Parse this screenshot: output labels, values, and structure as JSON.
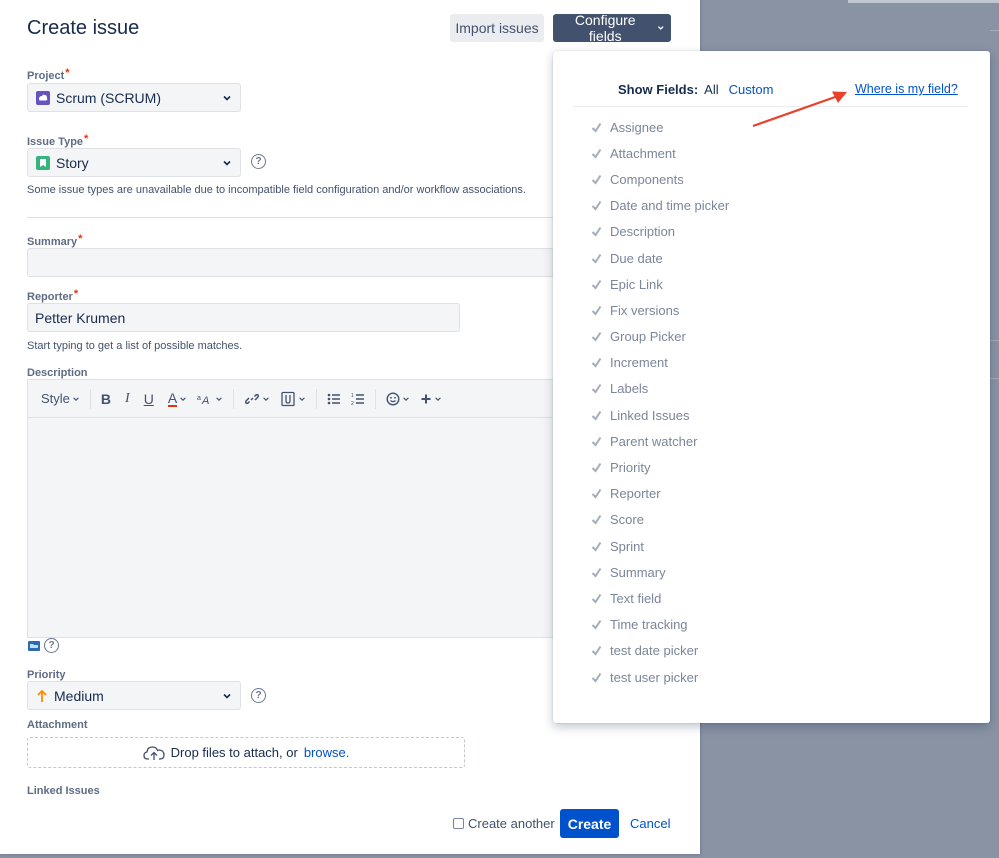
{
  "dialog": {
    "title": "Create issue",
    "import_label": "Import issues",
    "configure_label": "Configure fields"
  },
  "project": {
    "label": "Project",
    "value": "Scrum (SCRUM)"
  },
  "issue_type": {
    "label": "Issue Type",
    "value": "Story",
    "hint": "Some issue types are unavailable due to incompatible field configuration and/or workflow associations."
  },
  "summary": {
    "label": "Summary",
    "value": ""
  },
  "reporter": {
    "label": "Reporter",
    "value": "Petter Krumen",
    "hint": "Start typing to get a list of possible matches."
  },
  "description": {
    "label": "Description",
    "toolbar": {
      "style": "Style",
      "bold": "B",
      "italic": "I",
      "underline": "U",
      "color": "A"
    }
  },
  "priority": {
    "label": "Priority",
    "value": "Medium"
  },
  "attachment": {
    "label": "Attachment",
    "drop_text": "Drop files to attach, or",
    "browse": "browse."
  },
  "linked_issues": {
    "label": "Linked Issues"
  },
  "footer": {
    "create_another": "Create another",
    "create": "Create",
    "cancel": "Cancel"
  },
  "configure_panel": {
    "show_fields": "Show Fields:",
    "all": "All",
    "custom": "Custom",
    "where_link": "Where is my field?",
    "fields": [
      "Assignee",
      "Attachment",
      "Components",
      "Date and time picker",
      "Description",
      "Due date",
      "Epic Link",
      "Fix versions",
      "Group Picker",
      "Increment",
      "Labels",
      "Linked Issues",
      "Parent watcher",
      "Priority",
      "Reporter",
      "Score",
      "Sprint",
      "Summary",
      "Text field",
      "Time tracking",
      "test date picker",
      "test user picker"
    ]
  },
  "colors": {
    "primary": "#0052cc",
    "configure_bg": "#42526e",
    "required": "#de350b",
    "story_icon": "#36b37e",
    "priority_medium": "#ff8b00",
    "annotation_arrow": "#e8412c"
  }
}
